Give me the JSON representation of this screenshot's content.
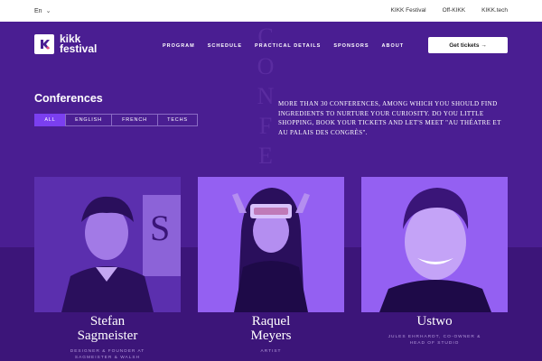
{
  "topbar": {
    "language": "En",
    "links": [
      "KIKK Festival",
      "Off-KIKK",
      "KIKK.tech"
    ]
  },
  "header": {
    "logo_line1": "kikk",
    "logo_line2": "festival",
    "nav": [
      "PROGRAM",
      "SCHEDULE",
      "PRACTICAL DETAILS",
      "SPONSORS",
      "ABOUT"
    ],
    "cta_label": "Get tickets →"
  },
  "watermark": [
    "C",
    "O",
    "N",
    "F",
    "E"
  ],
  "conferences": {
    "title": "Conferences",
    "filters": [
      "ALL",
      "ENGLISH",
      "FRENCH",
      "TECHS"
    ],
    "active_filter": "ALL",
    "intro": "MORE THAN 30 CONFERENCES, AMONG WHICH YOU SHOULD FIND INGREDIENTS TO NURTURE YOUR CURIOSITY. DO YOU LITTLE SHOPPING, BOOK YOUR TICKETS AND LET'S MEET \"AU THÉATRE ET AU PALAIS DES CONGRÈS\"."
  },
  "speakers": [
    {
      "name_line1": "Stefan",
      "name_line2": "Sagmeister",
      "role_line1": "DESIGNER & FOUNDER AT",
      "role_line2": "SAGMEISTER & WALSH"
    },
    {
      "name_line1": "Raquel",
      "name_line2": "Meyers",
      "role_line1": "ARTIST",
      "role_line2": ""
    },
    {
      "name_line1": "Ustwo",
      "name_line2": "",
      "role_line1": "JULES EHRHARDT, CO-OWNER &",
      "role_line2": "HEAD OF STUDIO"
    }
  ],
  "colors": {
    "background": "#4a1e92",
    "accent": "#7b3ff0",
    "photo_tint": "#8e5cf0"
  }
}
